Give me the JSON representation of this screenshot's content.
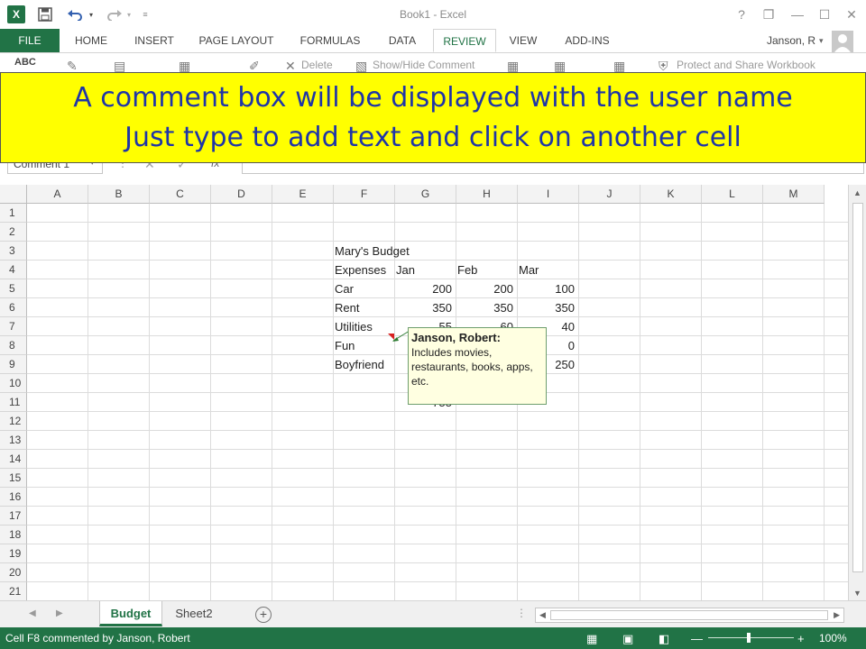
{
  "window": {
    "title": "Book1 - Excel",
    "qat": {
      "app_icon": "X",
      "save_icon": "save-icon",
      "undo_icon": "undo-icon",
      "redo_icon": "redo-icon"
    },
    "controls": {
      "help": "?",
      "restore": "❐",
      "minimize": "—",
      "maximize": "☐",
      "close": "✕"
    }
  },
  "ribbon": {
    "file_tab": "FILE",
    "tabs": [
      "HOME",
      "INSERT",
      "PAGE LAYOUT",
      "FORMULAS",
      "DATA",
      "REVIEW",
      "VIEW",
      "ADD-INS"
    ],
    "active_tab": "REVIEW",
    "user": "Janson, R",
    "spelling_label": "ABC",
    "delete_label": "Delete",
    "show_hide_comment_label": "Show/Hide Comment",
    "protect_workbook_label": "Protect and Share Workbook"
  },
  "banner": {
    "line1": "A comment box will be displayed with the user name",
    "line2": "Just type to add text and click on another cell"
  },
  "formula_bar": {
    "name_box": "Comment 1",
    "fx": "fx",
    "value": ""
  },
  "grid": {
    "columns": [
      "A",
      "B",
      "C",
      "D",
      "E",
      "F",
      "G",
      "H",
      "I",
      "J",
      "K",
      "L",
      "M"
    ],
    "rows": [
      "1",
      "2",
      "3",
      "4",
      "5",
      "6",
      "7",
      "8",
      "9",
      "10",
      "11",
      "12",
      "13",
      "14",
      "15",
      "16",
      "17",
      "18",
      "19",
      "20",
      "21"
    ],
    "title": "Mary's Budget",
    "headers": [
      "Expenses",
      "Jan",
      "Feb",
      "Mar"
    ],
    "labels": [
      "Car",
      "Rent",
      "Utilities",
      "Fun",
      "Boyfriend"
    ],
    "values": {
      "car": [
        "200",
        "200",
        "100"
      ],
      "rent": [
        "350",
        "350",
        "350"
      ],
      "utilities_g": "55",
      "utilities_h": "60",
      "utilities_i": "40",
      "fun_i": "0",
      "boyfriend_i": "250",
      "total_g": "755"
    }
  },
  "comment": {
    "author": "Janson, Robert:",
    "text": "Includes movies, restaurants, books, apps, etc."
  },
  "sheets": {
    "tabs": [
      "Budget",
      "Sheet2"
    ],
    "active": "Budget",
    "new_sheet": "+"
  },
  "status": {
    "text": "Cell F8 commented by Janson, Robert",
    "zoom": "100%"
  }
}
